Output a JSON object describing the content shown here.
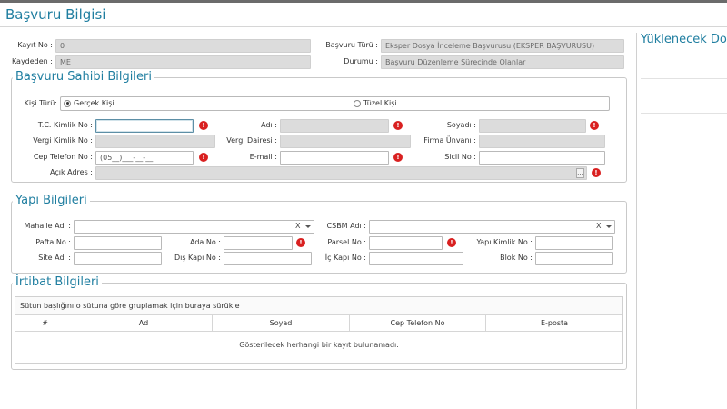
{
  "page": {
    "title": "Başvuru Bilgisi"
  },
  "basvuru": {
    "kayit_no_label": "Kayıt No :",
    "kayit_no_value": "0",
    "kaydeden_label": "Kaydeden :",
    "kaydeden_value": "ME",
    "basvuru_turu_label": "Başvuru Türü :",
    "basvuru_turu_value": "Eksper Dosya İnceleme Başvurusu (EKSPER BAŞVURUSU)",
    "durumu_label": "Durumu :",
    "durumu_value": "Başvuru Düzenleme Sürecinde Olanlar"
  },
  "sahibi": {
    "legend": "Başvuru Sahibi Bilgileri",
    "kisi_turu_label": "Kişi Türü:",
    "gercek_label": "Gerçek Kişi",
    "tuzel_label": "Tüzel Kişi",
    "tc_label": "T.C. Kimlik No :",
    "adi_label": "Adı :",
    "soyadi_label": "Soyadı :",
    "vergi_kimlik_label": "Vergi Kimlik No :",
    "vergi_dairesi_label": "Vergi Dairesi :",
    "firma_unvani_label": "Firma Ünvanı :",
    "cep_label": "Cep Telefon No :",
    "cep_value": "(05__)___-__-__",
    "email_label": "E-mail :",
    "sicil_label": "Sicil No :",
    "adres_label": "Açık Adres :",
    "adres_btn": "..."
  },
  "yapi": {
    "legend": "Yapı Bilgileri",
    "mahalle_label": "Mahalle Adı :",
    "csbm_label": "CSBM Adı :",
    "clear_symbol": "X",
    "pafta_label": "Pafta No :",
    "ada_label": "Ada No :",
    "parsel_label": "Parsel No :",
    "yapi_kimlik_label": "Yapı Kimlik No :",
    "site_label": "Site Adı :",
    "dis_kapi_label": "Dış Kapı No :",
    "ic_kapi_label": "İç Kapı No :",
    "blok_label": "Blok No :"
  },
  "irtibat": {
    "legend": "İrtibat Bilgileri",
    "group_hint": "Sütun başlığını o sütuna göre gruplamak için buraya sürükle",
    "columns": [
      "#",
      "Ad",
      "Soyad",
      "Cep Telefon No",
      "E-posta"
    ],
    "empty_text": "Gösterilecek herhangi bir kayıt bulunamadı."
  },
  "right": {
    "title": "Yüklenecek Do"
  },
  "colors": {
    "accent": "#1f7ea0",
    "warning": "#d92020",
    "readonly": "#dcdcdc"
  },
  "icons": {
    "warning": "exclamation-circle-icon",
    "dropdown": "chevron-down-icon"
  }
}
